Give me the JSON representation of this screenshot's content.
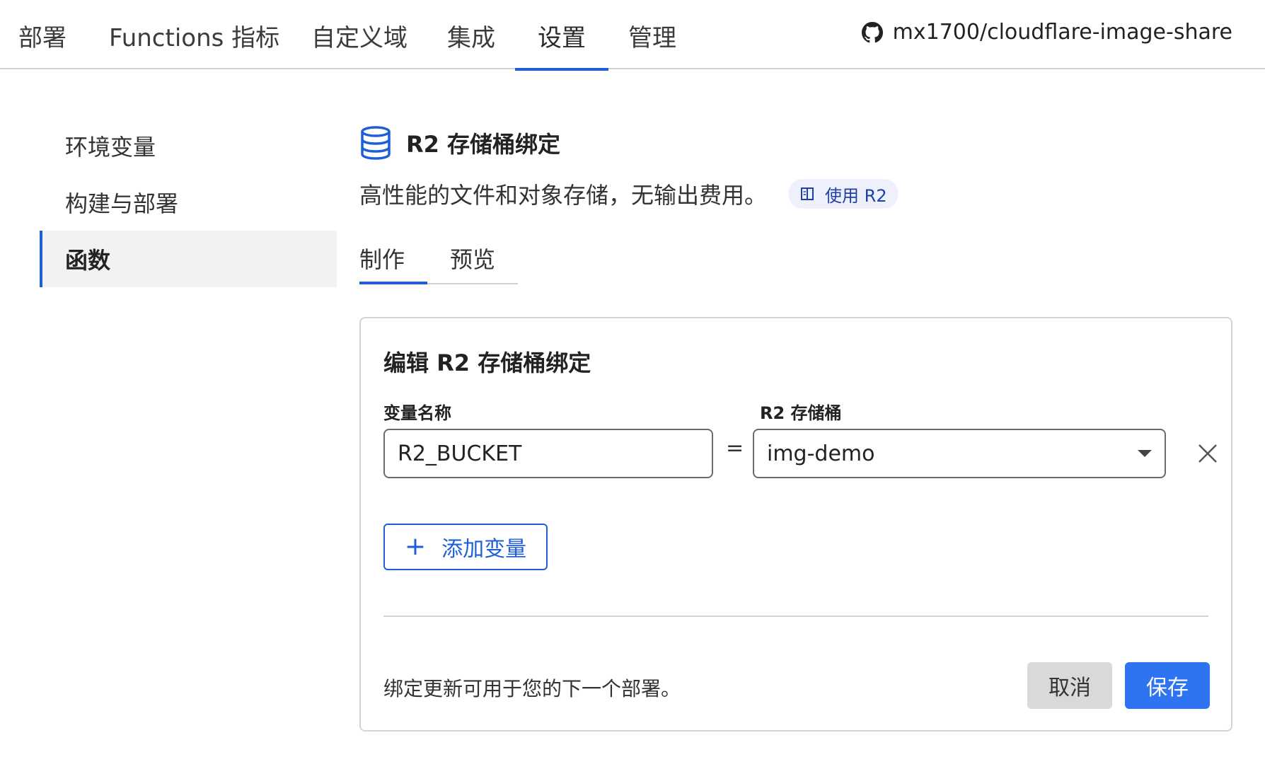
{
  "topnav": {
    "tabs": [
      {
        "label": "部署"
      },
      {
        "label": "Functions 指标"
      },
      {
        "label": "自定义域"
      },
      {
        "label": "集成"
      },
      {
        "label": "设置",
        "active": true
      },
      {
        "label": "管理"
      }
    ],
    "repo": {
      "icon": "github-icon",
      "label": "mx1700/cloudflare-image-share"
    }
  },
  "sidebar": {
    "items": [
      {
        "label": "环境变量"
      },
      {
        "label": "构建与部署"
      },
      {
        "label": "函数",
        "active": true
      }
    ]
  },
  "header": {
    "icon": "database-icon",
    "title": "R2 存储桶绑定",
    "description": "高性能的文件和对象存储，无输出费用。",
    "doc_link": {
      "icon": "book-icon",
      "label": "使用 R2"
    }
  },
  "subtabs": [
    {
      "label": "制作",
      "active": true
    },
    {
      "label": "预览"
    }
  ],
  "card": {
    "title": "编辑 R2 存储桶绑定",
    "var_label": "变量名称",
    "var_value": "R2_BUCKET",
    "equals": "=",
    "bucket_label": "R2 存储桶",
    "bucket_value": "img-demo",
    "add_label": "添加变量",
    "note": "绑定更新可用于您的下一个部署。",
    "cancel_label": "取消",
    "save_label": "保存"
  },
  "colors": {
    "accent": "#1e5fd8",
    "save": "#2e74f0",
    "badge_bg": "#eef1fb"
  }
}
